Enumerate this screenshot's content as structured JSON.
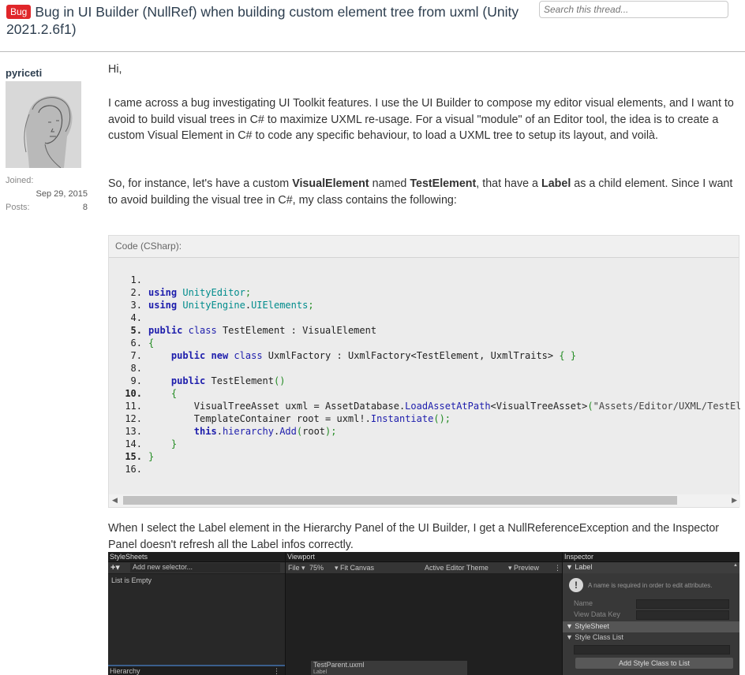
{
  "thread": {
    "badge": "Bug",
    "title": "Bug in UI Builder (NullRef) when building custom element tree from uxml (Unity 2021.2.6f1)",
    "search_placeholder": "Search this thread..."
  },
  "user": {
    "name": "pyriceti",
    "joined_label": "Joined:",
    "joined_value": "Sep 29, 2015",
    "posts_label": "Posts:",
    "posts_value": "8"
  },
  "post": {
    "greeting": "Hi,",
    "p1": "I came across a bug investigating UI Toolkit features. I use the UI Builder to compose my editor visual elements, and I want to avoid to build visual trees in C# to maximize UXML re-usage. For a visual \"module\" of an Editor tool, the idea is to create a custom Visual Element in C# to code any specific behaviour, to load a UXML tree to setup its layout, and voilà.",
    "p2_a": "So, for instance, let's have a custom ",
    "p2_b": "VisualElement",
    "p2_c": " named ",
    "p2_d": "TestElement",
    "p2_e": ", that have a ",
    "p2_f": "Label",
    "p2_g": " as a child element. Since I want to avoid building the visual tree in C#, my class contains the following:",
    "p3": "When I select the Label element in the Hierarchy Panel of the UI Builder, I get a NullReferenceException and the Inspector Panel doesn't refresh all the Label infos correctly."
  },
  "code": {
    "header": "Code (CSharp):",
    "numbers": [
      "1.",
      "2.",
      "3.",
      "4.",
      "5.",
      "6.",
      "7.",
      "8.",
      "9.",
      "10.",
      "11.",
      "12.",
      "13.",
      "14.",
      "15.",
      "16."
    ],
    "bold_numbers": [
      5,
      10,
      15
    ],
    "lines": [
      "",
      "using UnityEditor;",
      "using UnityEngine.UIElements;",
      "",
      "public class TestElement : VisualElement",
      "{",
      "    public new class UxmlFactory : UxmlFactory<TestElement, UxmlTraits> { }",
      "",
      "    public TestElement()",
      "    {",
      "        VisualTreeAsset uxml = AssetDatabase.LoadAssetAtPath<VisualTreeAsset>(\"Assets/Editor/UXML/TestEleme",
      "        TemplateContainer root = uxml!.Instantiate();",
      "        this.hierarchy.Add(root);",
      "    }",
      "}",
      ""
    ],
    "scroll_left": "◀",
    "scroll_right": "▶"
  },
  "unity": {
    "stylesheets_title": "StyleSheets",
    "add_selector": "Add new selector...",
    "list_empty": "List is Empty",
    "hierarchy_title": "Hierarchy",
    "viewport_title": "Viewport",
    "file_menu": "File ▾",
    "zoom": "75%",
    "fit_canvas": "▾ Fit Canvas",
    "theme": "Active Editor Theme",
    "preview": "▾ Preview",
    "doc_tab": "TestParent.uxml",
    "doc_sub": "Label",
    "inspector_title": "Inspector",
    "section_label": "▼ Label",
    "name_notice": "A name is required in order to edit attributes.",
    "field_name": "Name",
    "field_view_data_key": "View Data Key",
    "section_stylesheet": "▼ StyleSheet",
    "section_style_class_list": "▼ Style Class List",
    "add_style_class": "Add Style Class to List"
  }
}
